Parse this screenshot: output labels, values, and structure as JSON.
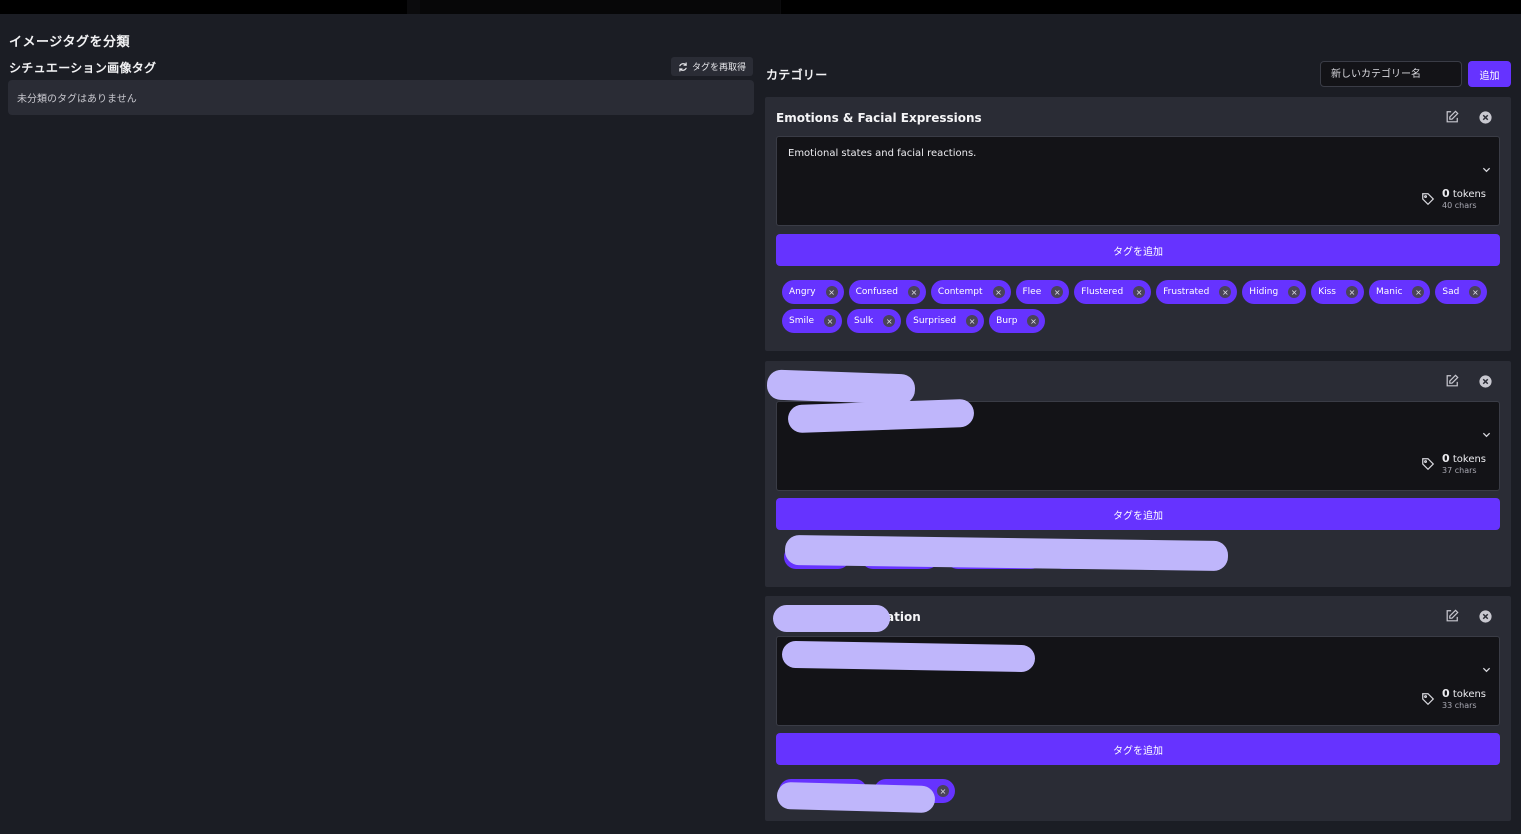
{
  "page_title": "イメージタグを分類",
  "left_panel": {
    "title": "シチュエーション画像タグ",
    "refetch_label": "タグを再取得",
    "empty_message": "未分類のタグはありません"
  },
  "right_panel": {
    "title": "カテゴリー",
    "new_category_placeholder": "新しいカテゴリー名",
    "add_label": "追加"
  },
  "categories": [
    {
      "name": "Emotions & Facial Expressions",
      "description": "Emotional states and facial reactions.",
      "tokens": "0",
      "tokens_unit": "tokens",
      "chars": "40 chars",
      "add_tag_label": "タグを追加",
      "tags": [
        "Angry",
        "Confused",
        "Contempt",
        "Flee",
        "Flustered",
        "Frustrated",
        "Hiding",
        "Kiss",
        "Manic",
        "Sad",
        "Smile",
        "Sulk",
        "Surprised",
        "Burp"
      ]
    },
    {
      "name": "",
      "description": "",
      "tokens": "0",
      "tokens_unit": "tokens",
      "chars": "37 chars",
      "add_tag_label": "タグを追加",
      "tags": []
    },
    {
      "name": "ation",
      "description": "",
      "tokens": "0",
      "tokens_unit": "tokens",
      "chars": "33 chars",
      "add_tag_label": "タグを追加",
      "tags": []
    }
  ],
  "colors": {
    "accent": "#6633ff",
    "background": "#1b1d24",
    "card": "#2a2c35",
    "field": "#131317"
  },
  "icons": [
    "refresh-icon",
    "edit-icon",
    "close-circle-icon",
    "chevron-down-icon",
    "tag-icon"
  ]
}
